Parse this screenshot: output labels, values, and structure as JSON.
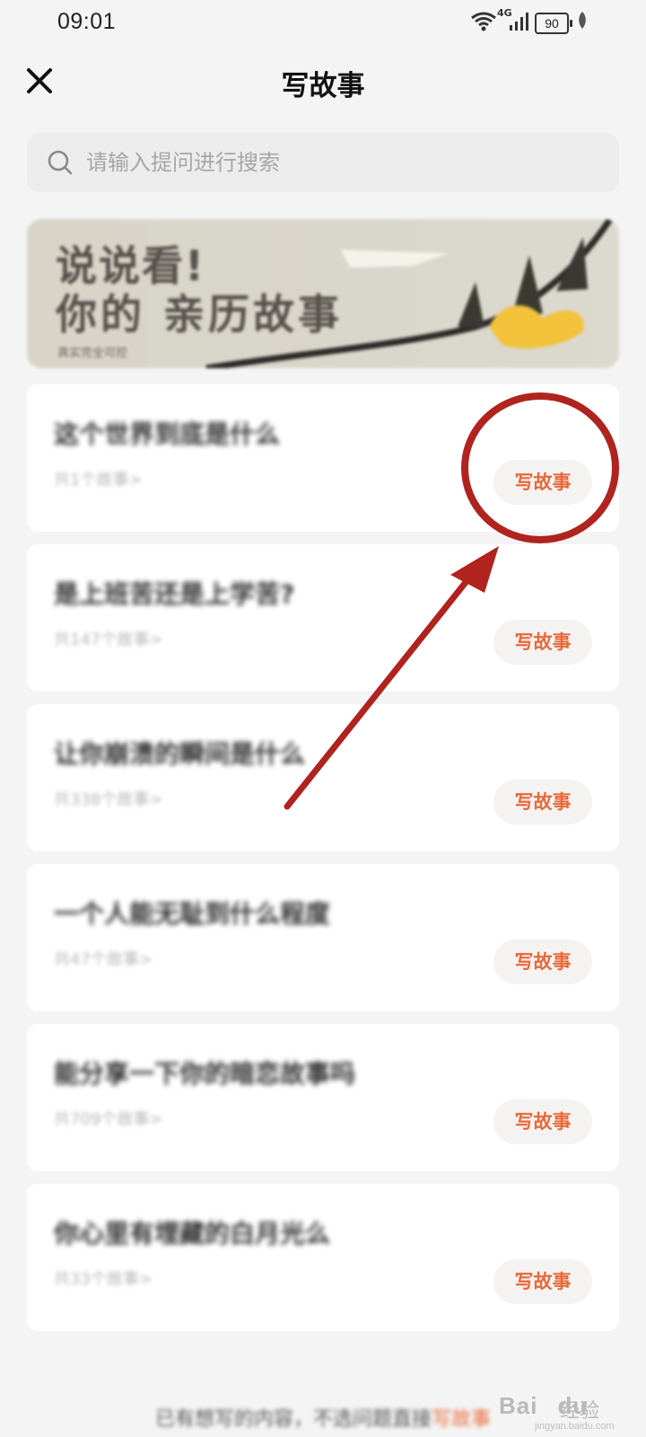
{
  "status_bar": {
    "time": "09:01",
    "network": "4G",
    "battery": "90",
    "icons": [
      "wifi-icon",
      "signal-icon",
      "battery-icon",
      "leaf-icon"
    ]
  },
  "header": {
    "title": "写故事",
    "close_icon": "close-icon"
  },
  "search": {
    "placeholder": "请输入提问进行搜索",
    "icon": "search-icon"
  },
  "banner": {
    "line1": "说说看!",
    "line2": "你的 亲历故事",
    "sub": "真实完全可控"
  },
  "questions": [
    {
      "title": "这个世界到底是什么",
      "count": "共1个故事>",
      "button": "写故事"
    },
    {
      "title": "是上班苦还是上学苦?",
      "count": "共147个故事>",
      "button": "写故事"
    },
    {
      "title": "让你崩溃的瞬间是什么",
      "count": "共338个故事>",
      "button": "写故事"
    },
    {
      "title": "一个人能无耻到什么程度",
      "count": "共47个故事>",
      "button": "写故事"
    },
    {
      "title": "能分享一下你的暗恋故事吗",
      "count": "共709个故事>",
      "button": "写故事"
    },
    {
      "title": "你心里有埋藏的白月光么",
      "count": "共33个故事>",
      "button": "写故事"
    }
  ],
  "footer": {
    "text": "已有想写的内容，不选问题直接",
    "link": "写故事"
  },
  "watermark": {
    "brand": "Bai",
    "brand2": "du",
    "suffix": "经验",
    "domain": "jingyan.baidu.com"
  },
  "colors": {
    "accent": "#e8683a",
    "annotation": "#b0231e"
  }
}
